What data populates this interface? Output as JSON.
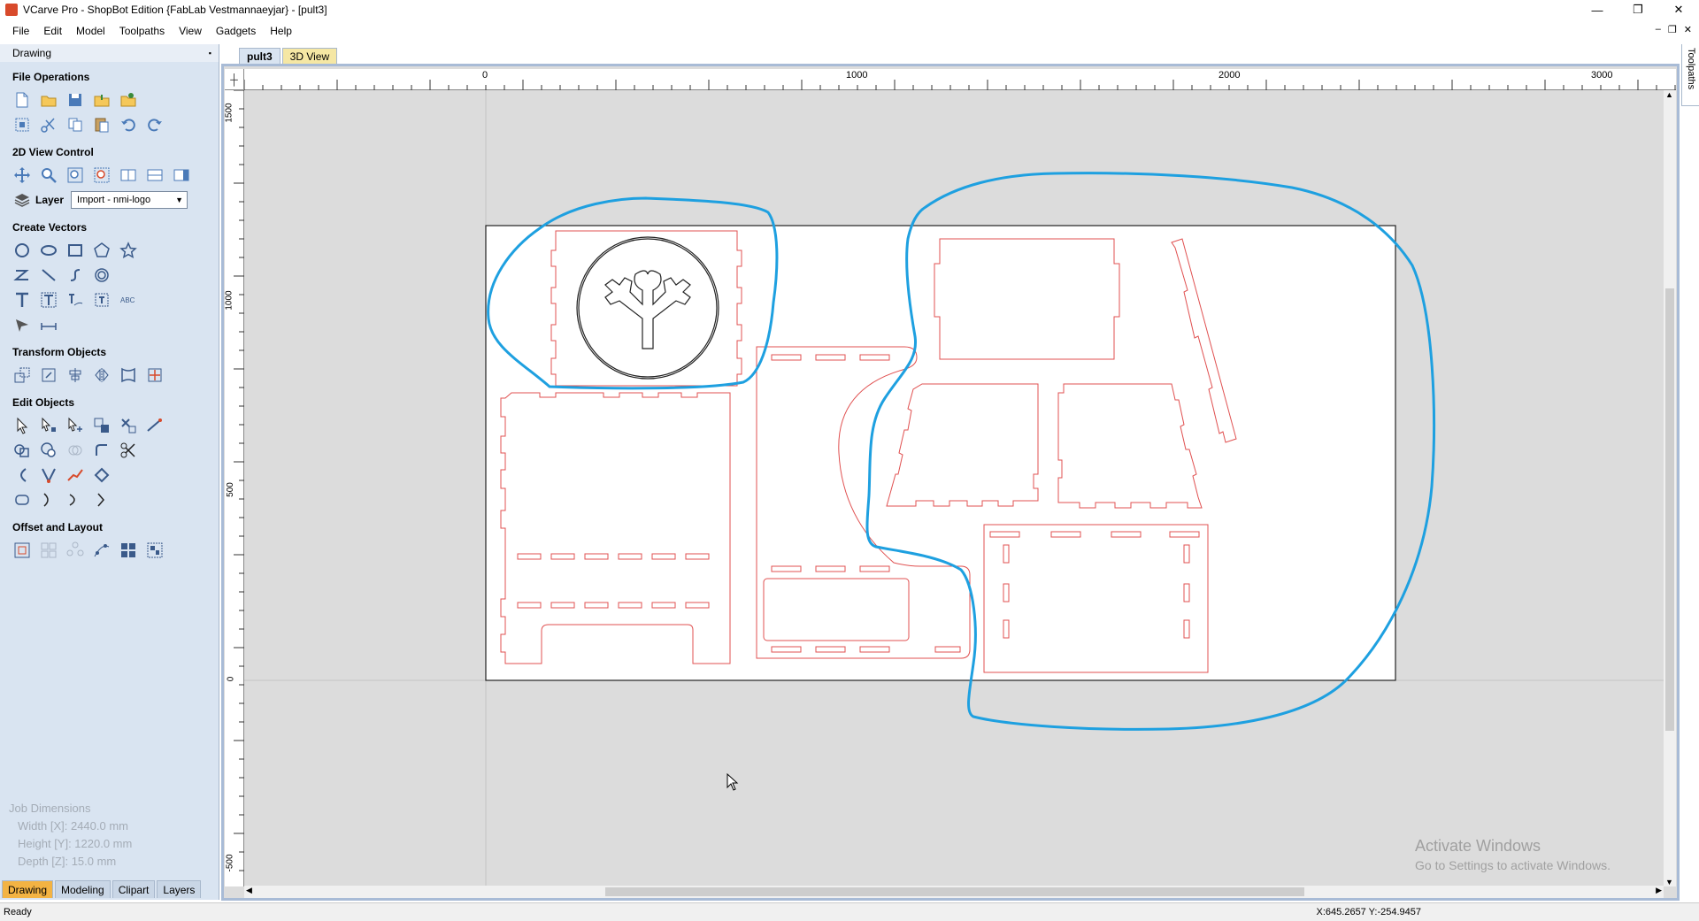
{
  "window": {
    "title": "VCarve Pro - ShopBot Edition {FabLab Vestmannaeyjar} - [pult3]",
    "minimize": "—",
    "maximize": "❐",
    "close": "✕"
  },
  "menu": [
    "File",
    "Edit",
    "Model",
    "Toolpaths",
    "View",
    "Gadgets",
    "Help"
  ],
  "mdi_controls": [
    "–",
    "❐",
    "✕"
  ],
  "left_panel": {
    "header": "Drawing",
    "pin": "📌",
    "sections": {
      "file_operations": "File Operations",
      "view_control": "2D View Control",
      "create_vectors": "Create Vectors",
      "transform_objects": "Transform Objects",
      "edit_objects": "Edit Objects",
      "offset_layout": "Offset and Layout"
    },
    "layer_label": "Layer",
    "layer_value": "Import - nmi-logo",
    "job_dimensions": {
      "title": "Job Dimensions",
      "width": "Width  [X]: 2440.0 mm",
      "height": "Height [Y]: 1220.0 mm",
      "depth": "Depth  [Z]: 15.0 mm"
    },
    "bottom_tabs": [
      "Drawing",
      "Modeling",
      "Clipart",
      "Layers"
    ]
  },
  "view_tabs": [
    "pult3",
    "3D View"
  ],
  "rulers": {
    "top_labels": [
      "0",
      "1000",
      "2000",
      "3000"
    ],
    "left_labels": [
      "1500",
      "1000",
      "500",
      "0",
      "-500"
    ]
  },
  "right_tab": "Toolpaths",
  "watermark": {
    "line1": "Activate Windows",
    "line2": "Go to Settings to activate Windows."
  },
  "status": {
    "left": "Ready",
    "coords": "X:645.2657 Y:-254.9457"
  },
  "colors": {
    "panel_bg": "#d9e4f1",
    "canvas_bg": "#dcdcdc",
    "vector_red": "#e05050",
    "annotation_blue": "#1ea0e0",
    "active_tab": "#f3b343"
  }
}
